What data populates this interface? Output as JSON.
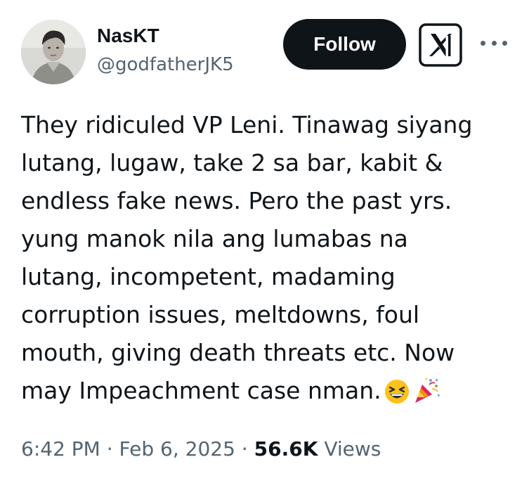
{
  "author": {
    "display_name": "NasKT",
    "handle": "@godfatherJK5",
    "avatar_icon": "profile-photo"
  },
  "actions": {
    "follow_label": "Follow",
    "logo_icon": "x-logo-icon",
    "more_icon": "more-options-icon"
  },
  "tweet": {
    "lines": [
      "They ridiculed VP Leni. Tinawag siyang",
      "lutang, lugaw, take 2 sa bar, kabit &",
      "endless fake news. Pero the past yrs.",
      "yung manok nila ang lumabas na",
      "lutang, incompetent, madaming",
      "corruption issues, meltdowns, foul",
      "mouth, giving death threats etc. Now",
      "may Impeachment case nman."
    ],
    "emojis": [
      "grinning-squinting-face-emoji",
      "party-popper-emoji"
    ]
  },
  "meta": {
    "time": "6:42 PM",
    "separator": "·",
    "date": "Feb 6, 2025",
    "views_count": "56.6K",
    "views_label": "Views"
  },
  "colors": {
    "text": "#0f1419",
    "secondary": "#536471",
    "button_bg": "#0f1419",
    "button_text": "#ffffff"
  }
}
